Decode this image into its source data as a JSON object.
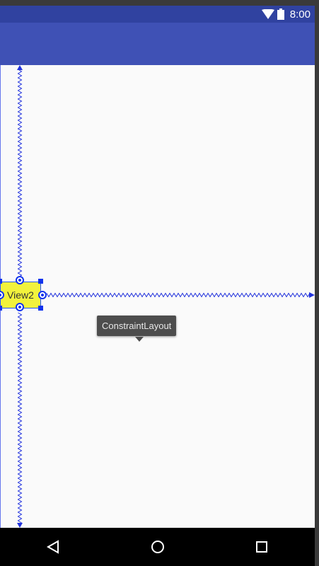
{
  "status_bar": {
    "time": "8:00",
    "icons": [
      "wifi-icon",
      "battery-icon"
    ]
  },
  "editor": {
    "widget_label": "View2",
    "tooltip": "ConstraintLayout"
  },
  "nav_bar": {
    "buttons": [
      "back-icon",
      "home-icon",
      "recents-icon"
    ]
  },
  "colors": {
    "status_bar": "#3042a0",
    "app_bar": "#3f51b5",
    "canvas": "#fafafa",
    "widget": "#f2f23c",
    "constraint": "#2233dd",
    "tooltip": "#4d4d4d"
  }
}
